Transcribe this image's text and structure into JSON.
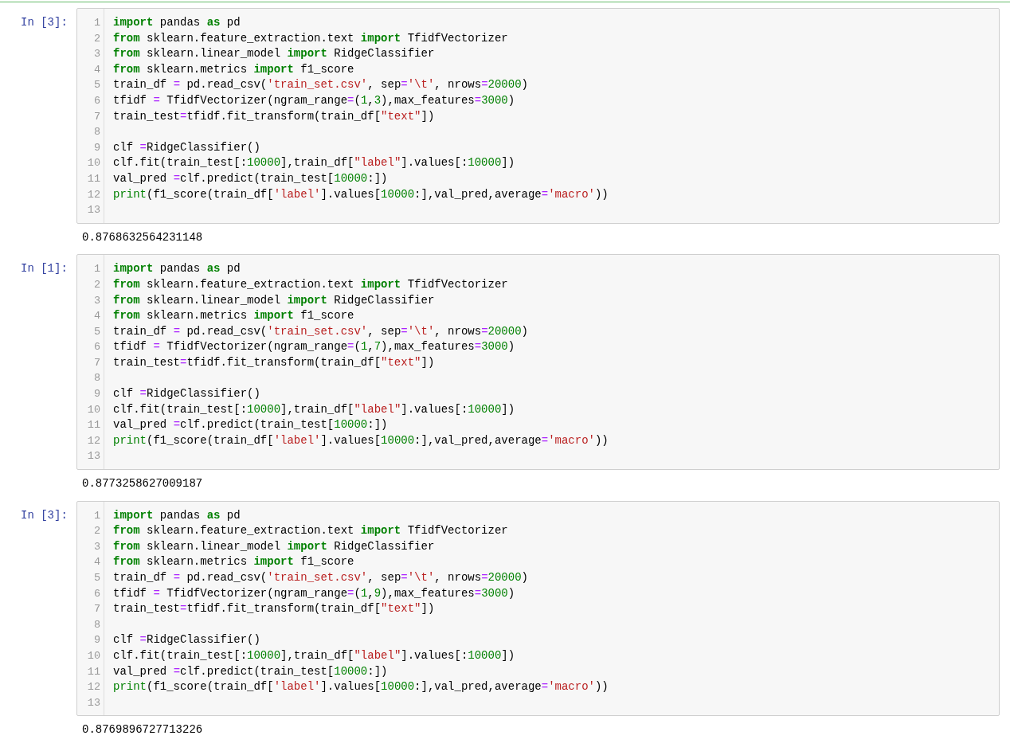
{
  "cells": [
    {
      "prompt": "In [3]:",
      "lines": [
        {
          "number": "1",
          "tokens": [
            {
              "kind": "k",
              "text": "import"
            },
            {
              "kind": "p",
              "text": " pandas "
            },
            {
              "kind": "k",
              "text": "as"
            },
            {
              "kind": "p",
              "text": " pd"
            }
          ]
        },
        {
          "number": "2",
          "tokens": [
            {
              "kind": "k",
              "text": "from"
            },
            {
              "kind": "p",
              "text": " sklearn.feature_extraction.text "
            },
            {
              "kind": "k",
              "text": "import"
            },
            {
              "kind": "p",
              "text": " TfidfVectorizer"
            }
          ]
        },
        {
          "number": "3",
          "tokens": [
            {
              "kind": "k",
              "text": "from"
            },
            {
              "kind": "p",
              "text": " sklearn.linear_model "
            },
            {
              "kind": "k",
              "text": "import"
            },
            {
              "kind": "p",
              "text": " RidgeClassifier"
            }
          ]
        },
        {
          "number": "4",
          "tokens": [
            {
              "kind": "k",
              "text": "from"
            },
            {
              "kind": "p",
              "text": " sklearn.metrics "
            },
            {
              "kind": "k",
              "text": "import"
            },
            {
              "kind": "p",
              "text": " f1_score"
            }
          ]
        },
        {
          "number": "5",
          "tokens": [
            {
              "kind": "p",
              "text": "train_df "
            },
            {
              "kind": "o",
              "text": "="
            },
            {
              "kind": "p",
              "text": " pd.read_csv("
            },
            {
              "kind": "s",
              "text": "'train_set.csv'"
            },
            {
              "kind": "p",
              "text": ", sep"
            },
            {
              "kind": "o",
              "text": "="
            },
            {
              "kind": "s",
              "text": "'\\t'"
            },
            {
              "kind": "p",
              "text": ", nrows"
            },
            {
              "kind": "o",
              "text": "="
            },
            {
              "kind": "n",
              "text": "20000"
            },
            {
              "kind": "p",
              "text": ")"
            }
          ]
        },
        {
          "number": "6",
          "tokens": [
            {
              "kind": "p",
              "text": "tfidf "
            },
            {
              "kind": "o",
              "text": "="
            },
            {
              "kind": "p",
              "text": " TfidfVectorizer(ngram_range"
            },
            {
              "kind": "o",
              "text": "="
            },
            {
              "kind": "p",
              "text": "("
            },
            {
              "kind": "n",
              "text": "1"
            },
            {
              "kind": "p",
              "text": ","
            },
            {
              "kind": "n",
              "text": "3"
            },
            {
              "kind": "p",
              "text": "),max_features"
            },
            {
              "kind": "o",
              "text": "="
            },
            {
              "kind": "n",
              "text": "3000"
            },
            {
              "kind": "p",
              "text": ")"
            }
          ]
        },
        {
          "number": "7",
          "tokens": [
            {
              "kind": "p",
              "text": "train_test"
            },
            {
              "kind": "o",
              "text": "="
            },
            {
              "kind": "p",
              "text": "tfidf.fit_transform(train_df["
            },
            {
              "kind": "s",
              "text": "\"text\""
            },
            {
              "kind": "p",
              "text": "])"
            }
          ]
        },
        {
          "number": "8"
        },
        {
          "number": "9",
          "tokens": [
            {
              "kind": "p",
              "text": "clf "
            },
            {
              "kind": "o",
              "text": "="
            },
            {
              "kind": "p",
              "text": "RidgeClassifier()"
            }
          ]
        },
        {
          "number": "10",
          "tokens": [
            {
              "kind": "p",
              "text": "clf.fit(train_test[:"
            },
            {
              "kind": "n",
              "text": "10000"
            },
            {
              "kind": "p",
              "text": "],train_df["
            },
            {
              "kind": "s",
              "text": "\"label\""
            },
            {
              "kind": "p",
              "text": "].values[:"
            },
            {
              "kind": "n",
              "text": "10000"
            },
            {
              "kind": "p",
              "text": "])"
            }
          ]
        },
        {
          "number": "11",
          "tokens": [
            {
              "kind": "p",
              "text": "val_pred "
            },
            {
              "kind": "o",
              "text": "="
            },
            {
              "kind": "p",
              "text": "clf.predict(train_test["
            },
            {
              "kind": "n",
              "text": "10000"
            },
            {
              "kind": "p",
              "text": ":])"
            }
          ]
        },
        {
          "number": "12",
          "tokens": [
            {
              "kind": "b",
              "text": "print"
            },
            {
              "kind": "p",
              "text": "(f1_score(train_df["
            },
            {
              "kind": "s",
              "text": "'label'"
            },
            {
              "kind": "p",
              "text": "].values["
            },
            {
              "kind": "n",
              "text": "10000"
            },
            {
              "kind": "p",
              "text": ":],val_pred,average"
            },
            {
              "kind": "o",
              "text": "="
            },
            {
              "kind": "s",
              "text": "'macro'"
            },
            {
              "kind": "p",
              "text": "))"
            }
          ]
        },
        {
          "number": "13"
        }
      ],
      "output": "0.8768632564231148"
    },
    {
      "prompt": "In [1]:",
      "lines": [
        {
          "number": "1",
          "tokens": [
            {
              "kind": "k",
              "text": "import"
            },
            {
              "kind": "p",
              "text": " pandas "
            },
            {
              "kind": "k",
              "text": "as"
            },
            {
              "kind": "p",
              "text": " pd"
            }
          ]
        },
        {
          "number": "2",
          "tokens": [
            {
              "kind": "k",
              "text": "from"
            },
            {
              "kind": "p",
              "text": " sklearn.feature_extraction.text "
            },
            {
              "kind": "k",
              "text": "import"
            },
            {
              "kind": "p",
              "text": " TfidfVectorizer"
            }
          ]
        },
        {
          "number": "3",
          "tokens": [
            {
              "kind": "k",
              "text": "from"
            },
            {
              "kind": "p",
              "text": " sklearn.linear_model "
            },
            {
              "kind": "k",
              "text": "import"
            },
            {
              "kind": "p",
              "text": " RidgeClassifier"
            }
          ]
        },
        {
          "number": "4",
          "tokens": [
            {
              "kind": "k",
              "text": "from"
            },
            {
              "kind": "p",
              "text": " sklearn.metrics "
            },
            {
              "kind": "k",
              "text": "import"
            },
            {
              "kind": "p",
              "text": " f1_score"
            }
          ]
        },
        {
          "number": "5",
          "tokens": [
            {
              "kind": "p",
              "text": "train_df "
            },
            {
              "kind": "o",
              "text": "="
            },
            {
              "kind": "p",
              "text": " pd.read_csv("
            },
            {
              "kind": "s",
              "text": "'train_set.csv'"
            },
            {
              "kind": "p",
              "text": ", sep"
            },
            {
              "kind": "o",
              "text": "="
            },
            {
              "kind": "s",
              "text": "'\\t'"
            },
            {
              "kind": "p",
              "text": ", nrows"
            },
            {
              "kind": "o",
              "text": "="
            },
            {
              "kind": "n",
              "text": "20000"
            },
            {
              "kind": "p",
              "text": ")"
            }
          ]
        },
        {
          "number": "6",
          "tokens": [
            {
              "kind": "p",
              "text": "tfidf "
            },
            {
              "kind": "o",
              "text": "="
            },
            {
              "kind": "p",
              "text": " TfidfVectorizer(ngram_range"
            },
            {
              "kind": "o",
              "text": "="
            },
            {
              "kind": "p",
              "text": "("
            },
            {
              "kind": "n",
              "text": "1"
            },
            {
              "kind": "p",
              "text": ","
            },
            {
              "kind": "n",
              "text": "7"
            },
            {
              "kind": "p",
              "text": "),max_features"
            },
            {
              "kind": "o",
              "text": "="
            },
            {
              "kind": "n",
              "text": "3000"
            },
            {
              "kind": "p",
              "text": ")"
            }
          ]
        },
        {
          "number": "7",
          "tokens": [
            {
              "kind": "p",
              "text": "train_test"
            },
            {
              "kind": "o",
              "text": "="
            },
            {
              "kind": "p",
              "text": "tfidf.fit_transform(train_df["
            },
            {
              "kind": "s",
              "text": "\"text\""
            },
            {
              "kind": "p",
              "text": "])"
            }
          ]
        },
        {
          "number": "8"
        },
        {
          "number": "9",
          "tokens": [
            {
              "kind": "p",
              "text": "clf "
            },
            {
              "kind": "o",
              "text": "="
            },
            {
              "kind": "p",
              "text": "RidgeClassifier()"
            }
          ]
        },
        {
          "number": "10",
          "tokens": [
            {
              "kind": "p",
              "text": "clf.fit(train_test[:"
            },
            {
              "kind": "n",
              "text": "10000"
            },
            {
              "kind": "p",
              "text": "],train_df["
            },
            {
              "kind": "s",
              "text": "\"label\""
            },
            {
              "kind": "p",
              "text": "].values[:"
            },
            {
              "kind": "n",
              "text": "10000"
            },
            {
              "kind": "p",
              "text": "])"
            }
          ]
        },
        {
          "number": "11",
          "tokens": [
            {
              "kind": "p",
              "text": "val_pred "
            },
            {
              "kind": "o",
              "text": "="
            },
            {
              "kind": "p",
              "text": "clf.predict(train_test["
            },
            {
              "kind": "n",
              "text": "10000"
            },
            {
              "kind": "p",
              "text": ":])"
            }
          ]
        },
        {
          "number": "12",
          "tokens": [
            {
              "kind": "b",
              "text": "print"
            },
            {
              "kind": "p",
              "text": "(f1_score(train_df["
            },
            {
              "kind": "s",
              "text": "'label'"
            },
            {
              "kind": "p",
              "text": "].values["
            },
            {
              "kind": "n",
              "text": "10000"
            },
            {
              "kind": "p",
              "text": ":],val_pred,average"
            },
            {
              "kind": "o",
              "text": "="
            },
            {
              "kind": "s",
              "text": "'macro'"
            },
            {
              "kind": "p",
              "text": "))"
            }
          ]
        },
        {
          "number": "13"
        }
      ],
      "output": "0.8773258627009187"
    },
    {
      "prompt": "In [3]:",
      "lines": [
        {
          "number": "1",
          "tokens": [
            {
              "kind": "k",
              "text": "import"
            },
            {
              "kind": "p",
              "text": " pandas "
            },
            {
              "kind": "k",
              "text": "as"
            },
            {
              "kind": "p",
              "text": " pd"
            }
          ]
        },
        {
          "number": "2",
          "tokens": [
            {
              "kind": "k",
              "text": "from"
            },
            {
              "kind": "p",
              "text": " sklearn.feature_extraction.text "
            },
            {
              "kind": "k",
              "text": "import"
            },
            {
              "kind": "p",
              "text": " TfidfVectorizer"
            }
          ]
        },
        {
          "number": "3",
          "tokens": [
            {
              "kind": "k",
              "text": "from"
            },
            {
              "kind": "p",
              "text": " sklearn.linear_model "
            },
            {
              "kind": "k",
              "text": "import"
            },
            {
              "kind": "p",
              "text": " RidgeClassifier"
            }
          ]
        },
        {
          "number": "4",
          "tokens": [
            {
              "kind": "k",
              "text": "from"
            },
            {
              "kind": "p",
              "text": " sklearn.metrics "
            },
            {
              "kind": "k",
              "text": "import"
            },
            {
              "kind": "p",
              "text": " f1_score"
            }
          ]
        },
        {
          "number": "5",
          "tokens": [
            {
              "kind": "p",
              "text": "train_df "
            },
            {
              "kind": "o",
              "text": "="
            },
            {
              "kind": "p",
              "text": " pd.read_csv("
            },
            {
              "kind": "s",
              "text": "'train_set.csv'"
            },
            {
              "kind": "p",
              "text": ", sep"
            },
            {
              "kind": "o",
              "text": "="
            },
            {
              "kind": "s",
              "text": "'\\t'"
            },
            {
              "kind": "p",
              "text": ", nrows"
            },
            {
              "kind": "o",
              "text": "="
            },
            {
              "kind": "n",
              "text": "20000"
            },
            {
              "kind": "p",
              "text": ")"
            }
          ]
        },
        {
          "number": "6",
          "tokens": [
            {
              "kind": "p",
              "text": "tfidf "
            },
            {
              "kind": "o",
              "text": "="
            },
            {
              "kind": "p",
              "text": " TfidfVectorizer(ngram_range"
            },
            {
              "kind": "o",
              "text": "="
            },
            {
              "kind": "p",
              "text": "("
            },
            {
              "kind": "n",
              "text": "1"
            },
            {
              "kind": "p",
              "text": ","
            },
            {
              "kind": "n",
              "text": "9"
            },
            {
              "kind": "p",
              "text": "),max_features"
            },
            {
              "kind": "o",
              "text": "="
            },
            {
              "kind": "n",
              "text": "3000"
            },
            {
              "kind": "p",
              "text": ")"
            }
          ]
        },
        {
          "number": "7",
          "tokens": [
            {
              "kind": "p",
              "text": "train_test"
            },
            {
              "kind": "o",
              "text": "="
            },
            {
              "kind": "p",
              "text": "tfidf.fit_transform(train_df["
            },
            {
              "kind": "s",
              "text": "\"text\""
            },
            {
              "kind": "p",
              "text": "])"
            }
          ]
        },
        {
          "number": "8"
        },
        {
          "number": "9",
          "tokens": [
            {
              "kind": "p",
              "text": "clf "
            },
            {
              "kind": "o",
              "text": "="
            },
            {
              "kind": "p",
              "text": "RidgeClassifier()"
            }
          ]
        },
        {
          "number": "10",
          "tokens": [
            {
              "kind": "p",
              "text": "clf.fit(train_test[:"
            },
            {
              "kind": "n",
              "text": "10000"
            },
            {
              "kind": "p",
              "text": "],train_df["
            },
            {
              "kind": "s",
              "text": "\"label\""
            },
            {
              "kind": "p",
              "text": "].values[:"
            },
            {
              "kind": "n",
              "text": "10000"
            },
            {
              "kind": "p",
              "text": "])"
            }
          ]
        },
        {
          "number": "11",
          "tokens": [
            {
              "kind": "p",
              "text": "val_pred "
            },
            {
              "kind": "o",
              "text": "="
            },
            {
              "kind": "p",
              "text": "clf.predict(train_test["
            },
            {
              "kind": "n",
              "text": "10000"
            },
            {
              "kind": "p",
              "text": ":])"
            }
          ]
        },
        {
          "number": "12",
          "tokens": [
            {
              "kind": "b",
              "text": "print"
            },
            {
              "kind": "p",
              "text": "(f1_score(train_df["
            },
            {
              "kind": "s",
              "text": "'label'"
            },
            {
              "kind": "p",
              "text": "].values["
            },
            {
              "kind": "n",
              "text": "10000"
            },
            {
              "kind": "p",
              "text": ":],val_pred,average"
            },
            {
              "kind": "o",
              "text": "="
            },
            {
              "kind": "s",
              "text": "'macro'"
            },
            {
              "kind": "p",
              "text": "))"
            }
          ]
        },
        {
          "number": "13"
        }
      ],
      "output": "0.8769896727713226"
    }
  ]
}
